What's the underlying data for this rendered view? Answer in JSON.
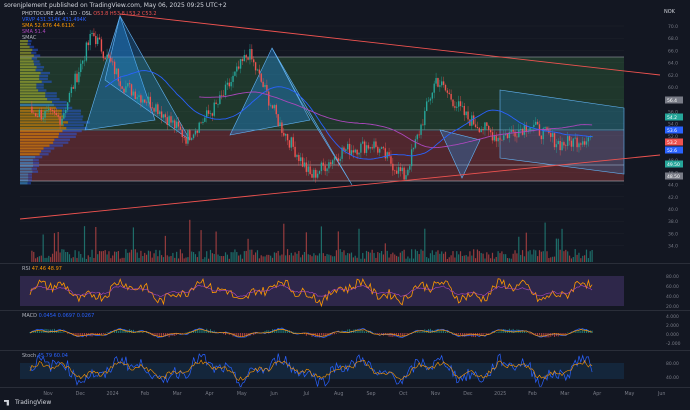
{
  "header": {
    "publisher_line": "sorenjplement published on TradingView.com, May 06, 2025 09:25 UTC+2"
  },
  "legend": {
    "symbol_line": "PHOTOCURE ASA · 1D · OSL",
    "ohlc_line": "O53.8 H53.8 L53.2 C53.2",
    "vrvp_line": "VRVP 431.314K 431.494K",
    "sma1_line": "SMA 52.676 44.611K",
    "sma2_line": "SMA 51.4",
    "smac_line": "SMAC"
  },
  "currency": "NOK",
  "price_axis": {
    "ticks": [
      "70.0",
      "68.0",
      "66.0",
      "64.0",
      "62.0",
      "60.0",
      "58.0",
      "56.0",
      "54.0",
      "52.0",
      "50.0",
      "48.0",
      "46.0",
      "44.0",
      "42.0",
      "40.0",
      "38.0",
      "36.0",
      "34.0"
    ],
    "tags": [
      {
        "text": "56.4",
        "color": "#787b86"
      },
      {
        "text": "54.2",
        "color": "#26a69a"
      },
      {
        "text": "53.6",
        "color": "#2962ff"
      },
      {
        "text": "53.2",
        "color": "#ef5350"
      },
      {
        "text": "52.6",
        "color": "#2962ff"
      },
      {
        "text": "49.50",
        "color": "#26a69a"
      },
      {
        "text": "48.50",
        "color": "#787b86"
      }
    ]
  },
  "rsi": {
    "label": "RSI",
    "value_text": "47.46 48.97",
    "ticks": [
      "80.00",
      "60.00",
      "40.00",
      "20.00"
    ]
  },
  "macd": {
    "label": "MACD",
    "value_text": "0.0454 0.0697 0.0267",
    "ticks": [
      "4.000",
      "2.000",
      "0.000",
      "-2.000"
    ]
  },
  "stoch": {
    "label": "Stoch",
    "value_text": "45.79 60.04",
    "ticks": [
      "80.00",
      "40.00"
    ]
  },
  "x_axis": {
    "labels": [
      "Nov",
      "Dec",
      "2024",
      "Feb",
      "Mar",
      "Apr",
      "May",
      "Jun",
      "Jul",
      "Aug",
      "Sep",
      "Oct",
      "Nov",
      "Dec",
      "2025",
      "Feb",
      "Mar",
      "Apr",
      "May",
      "Jun"
    ]
  },
  "brand": "TradingView",
  "colors": {
    "up": "#26a69a",
    "down": "#ef5350",
    "bg": "#131722",
    "sma": "#2962ff"
  },
  "chart_data": {
    "type": "candlestick",
    "title": "PHOTOCURE ASA · 1D · OSL",
    "ylabel": "NOK",
    "ylim": [
      34,
      71
    ],
    "zones": [
      {
        "name": "supply",
        "from": 54,
        "to": 65,
        "color": "#4caf50"
      },
      {
        "name": "demand",
        "from": 47,
        "to": 54,
        "color": "#ef5350"
      }
    ],
    "series": [
      {
        "name": "price",
        "x": [
          "Nov",
          "Dec",
          "2024",
          "Feb",
          "Mar",
          "Apr",
          "May",
          "Jun",
          "Jul",
          "Aug",
          "Sep",
          "Oct",
          "Nov",
          "Dec",
          "2025",
          "Feb",
          "Mar",
          "Apr",
          "May"
        ],
        "values": [
          57,
          56,
          69,
          61,
          58,
          53,
          58,
          66,
          55,
          47,
          51,
          52,
          47,
          62,
          56,
          53,
          55,
          52,
          53.2
        ]
      }
    ]
  }
}
